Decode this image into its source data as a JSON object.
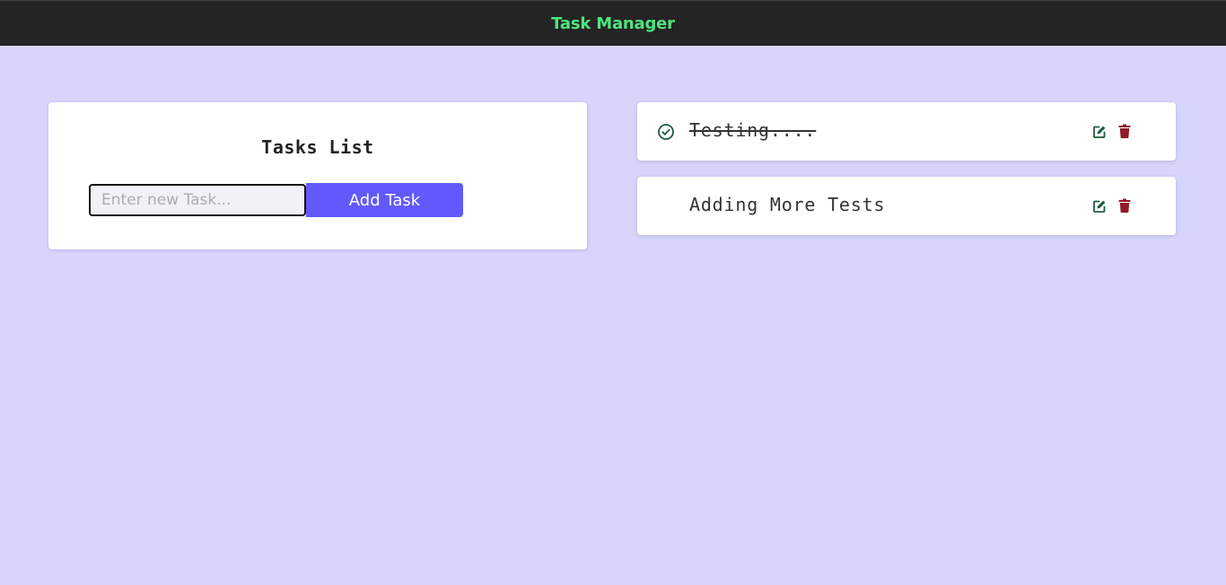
{
  "header": {
    "title": "Task Manager",
    "title_color": "#4fe57e",
    "background": "#242424"
  },
  "form": {
    "heading": "Tasks List",
    "input_placeholder": "Enter new Task...",
    "input_value": "",
    "add_button_label": "Add Task",
    "button_color": "#6259fd"
  },
  "tasks": [
    {
      "text": "Testing....",
      "completed": true,
      "status_icon": "check-circle-icon",
      "edit_icon": "edit-icon",
      "delete_icon": "trash-icon"
    },
    {
      "text": "Adding More Tests",
      "completed": false,
      "edit_icon": "edit-icon",
      "delete_icon": "trash-icon"
    }
  ],
  "colors": {
    "page_background": "#d8d5fd",
    "edit_icon": "#1d5c3d",
    "delete_icon": "#8f1c26",
    "check_icon": "#1d5c3d"
  }
}
